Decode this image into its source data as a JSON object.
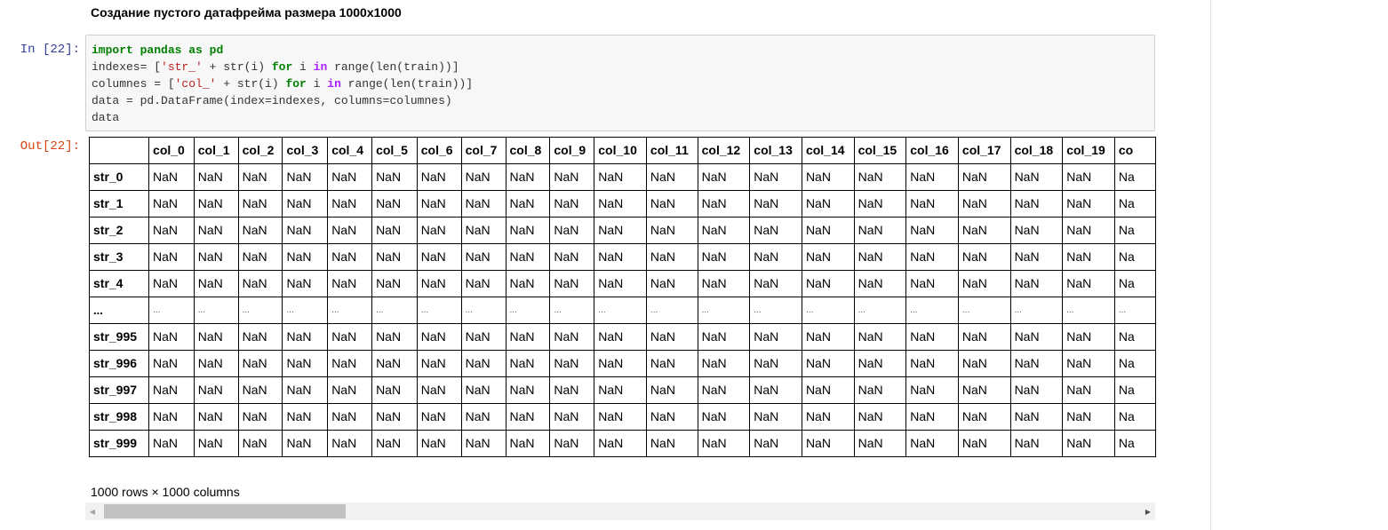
{
  "markdown": {
    "heading": "Создание пустого датафрейма размера 1000х1000"
  },
  "input_cell": {
    "prompt": "In [22]:",
    "code": [
      [
        {
          "t": "import",
          "c": "kw"
        },
        {
          "t": " "
        },
        {
          "t": "pandas",
          "c": "kw"
        },
        {
          "t": " "
        },
        {
          "t": "as",
          "c": "kw"
        },
        {
          "t": " "
        },
        {
          "t": "pd",
          "c": "kw"
        }
      ],
      [
        {
          "t": "indexes= ["
        },
        {
          "t": "'str_'",
          "c": "str"
        },
        {
          "t": " + str(i) "
        },
        {
          "t": "for",
          "c": "kw"
        },
        {
          "t": " i "
        },
        {
          "t": "in",
          "c": "kw2"
        },
        {
          "t": " range(len(train))]"
        }
      ],
      [
        {
          "t": "columnes = ["
        },
        {
          "t": "'col_'",
          "c": "str"
        },
        {
          "t": " + str(i) "
        },
        {
          "t": "for",
          "c": "kw"
        },
        {
          "t": " i "
        },
        {
          "t": "in",
          "c": "kw2"
        },
        {
          "t": " range(len(train))]"
        }
      ],
      [
        {
          "t": "data = pd.DataFrame(index=indexes, columns=columnes)"
        }
      ],
      [
        {
          "t": "data"
        }
      ]
    ]
  },
  "output_cell": {
    "prompt": "Out[22]:",
    "columns": [
      "col_0",
      "col_1",
      "col_2",
      "col_3",
      "col_4",
      "col_5",
      "col_6",
      "col_7",
      "col_8",
      "col_9",
      "col_10",
      "col_11",
      "col_12",
      "col_13",
      "col_14",
      "col_15",
      "col_16",
      "col_17",
      "col_18",
      "col_19",
      "co"
    ],
    "column_widths": [
      52,
      51,
      51,
      52,
      51,
      52,
      51,
      51,
      51,
      51,
      60,
      59,
      60,
      60,
      60,
      60,
      60,
      60,
      60,
      60,
      50
    ],
    "rows": [
      "str_0",
      "str_1",
      "str_2",
      "str_3",
      "str_4",
      "...",
      "str_995",
      "str_996",
      "str_997",
      "str_998",
      "str_999"
    ],
    "cell_value": "NaN",
    "truncated_cell_value": "Na",
    "ellipsis_value": "...",
    "footer": "1000 rows × 1000 columns"
  },
  "scrollbar": {
    "left_arrow": "◀",
    "right_arrow": "▶"
  }
}
